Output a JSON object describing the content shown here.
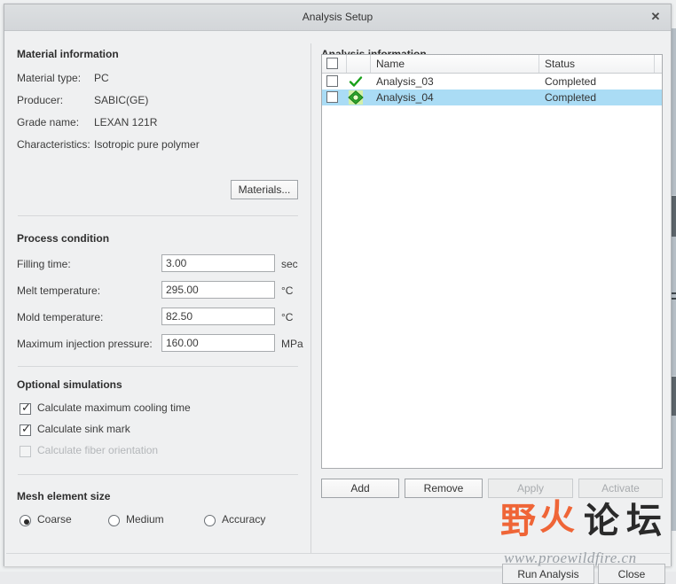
{
  "window": {
    "title": "Analysis Setup",
    "close_label": "✕"
  },
  "material_information": {
    "section_title": "Material information",
    "fields": [
      {
        "label": "Material type:",
        "value": "PC"
      },
      {
        "label": "Producer:",
        "value": "SABIC(GE)"
      },
      {
        "label": "Grade name:",
        "value": "LEXAN 121R"
      },
      {
        "label": "Characteristics:",
        "value": "Isotropic pure polymer"
      }
    ],
    "materials_button": "Materials..."
  },
  "process_condition": {
    "section_title": "Process condition",
    "fields": [
      {
        "label": "Filling time:",
        "value": "3.00",
        "unit": "sec"
      },
      {
        "label": "Melt temperature:",
        "value": "295.00",
        "unit": "°C"
      },
      {
        "label": "Mold temperature:",
        "value": "82.50",
        "unit": "°C"
      },
      {
        "label": "Maximum injection pressure:",
        "value": "160.00",
        "unit": "MPa"
      }
    ]
  },
  "optional_simulations": {
    "section_title": "Optional simulations",
    "items": [
      {
        "label": "Calculate maximum cooling time",
        "checked": true,
        "enabled": true
      },
      {
        "label": "Calculate sink mark",
        "checked": true,
        "enabled": true
      },
      {
        "label": "Calculate fiber orientation",
        "checked": false,
        "enabled": false
      }
    ]
  },
  "mesh_element_size": {
    "section_title": "Mesh element size",
    "options": [
      {
        "label": "Coarse",
        "selected": true
      },
      {
        "label": "Medium",
        "selected": false
      },
      {
        "label": "Accuracy",
        "selected": false
      }
    ]
  },
  "analysis_information": {
    "section_title": "Analysis information",
    "columns": [
      "",
      "",
      "Name",
      "Status",
      ""
    ],
    "rows": [
      {
        "checked": false,
        "icon": "green-check-icon",
        "name": "Analysis_03",
        "status": "Completed",
        "selected": false
      },
      {
        "checked": false,
        "icon": "green-diamond-icon",
        "name": "Analysis_04",
        "status": "Completed",
        "selected": true
      }
    ],
    "buttons": [
      {
        "label": "Add",
        "enabled": true
      },
      {
        "label": "Remove",
        "enabled": true
      },
      {
        "label": "Apply",
        "enabled": false
      },
      {
        "label": "Activate",
        "enabled": false
      }
    ]
  },
  "footer": {
    "run_analysis": "Run Analysis",
    "close": "Close"
  },
  "watermark": {
    "char1": "野",
    "char2": "火",
    "char3": "论",
    "char4": "坛",
    "url": "www.proewildfire.cn",
    "accent_color": "#ef5a28",
    "dark_color": "#1a1a1a"
  },
  "colors": {
    "dialog_bg": "#eff0f1",
    "titlebar": "#d6d9dc",
    "selection": "#aadcf5",
    "icon_green": "#18a01a",
    "text": "#3c3c3c"
  }
}
